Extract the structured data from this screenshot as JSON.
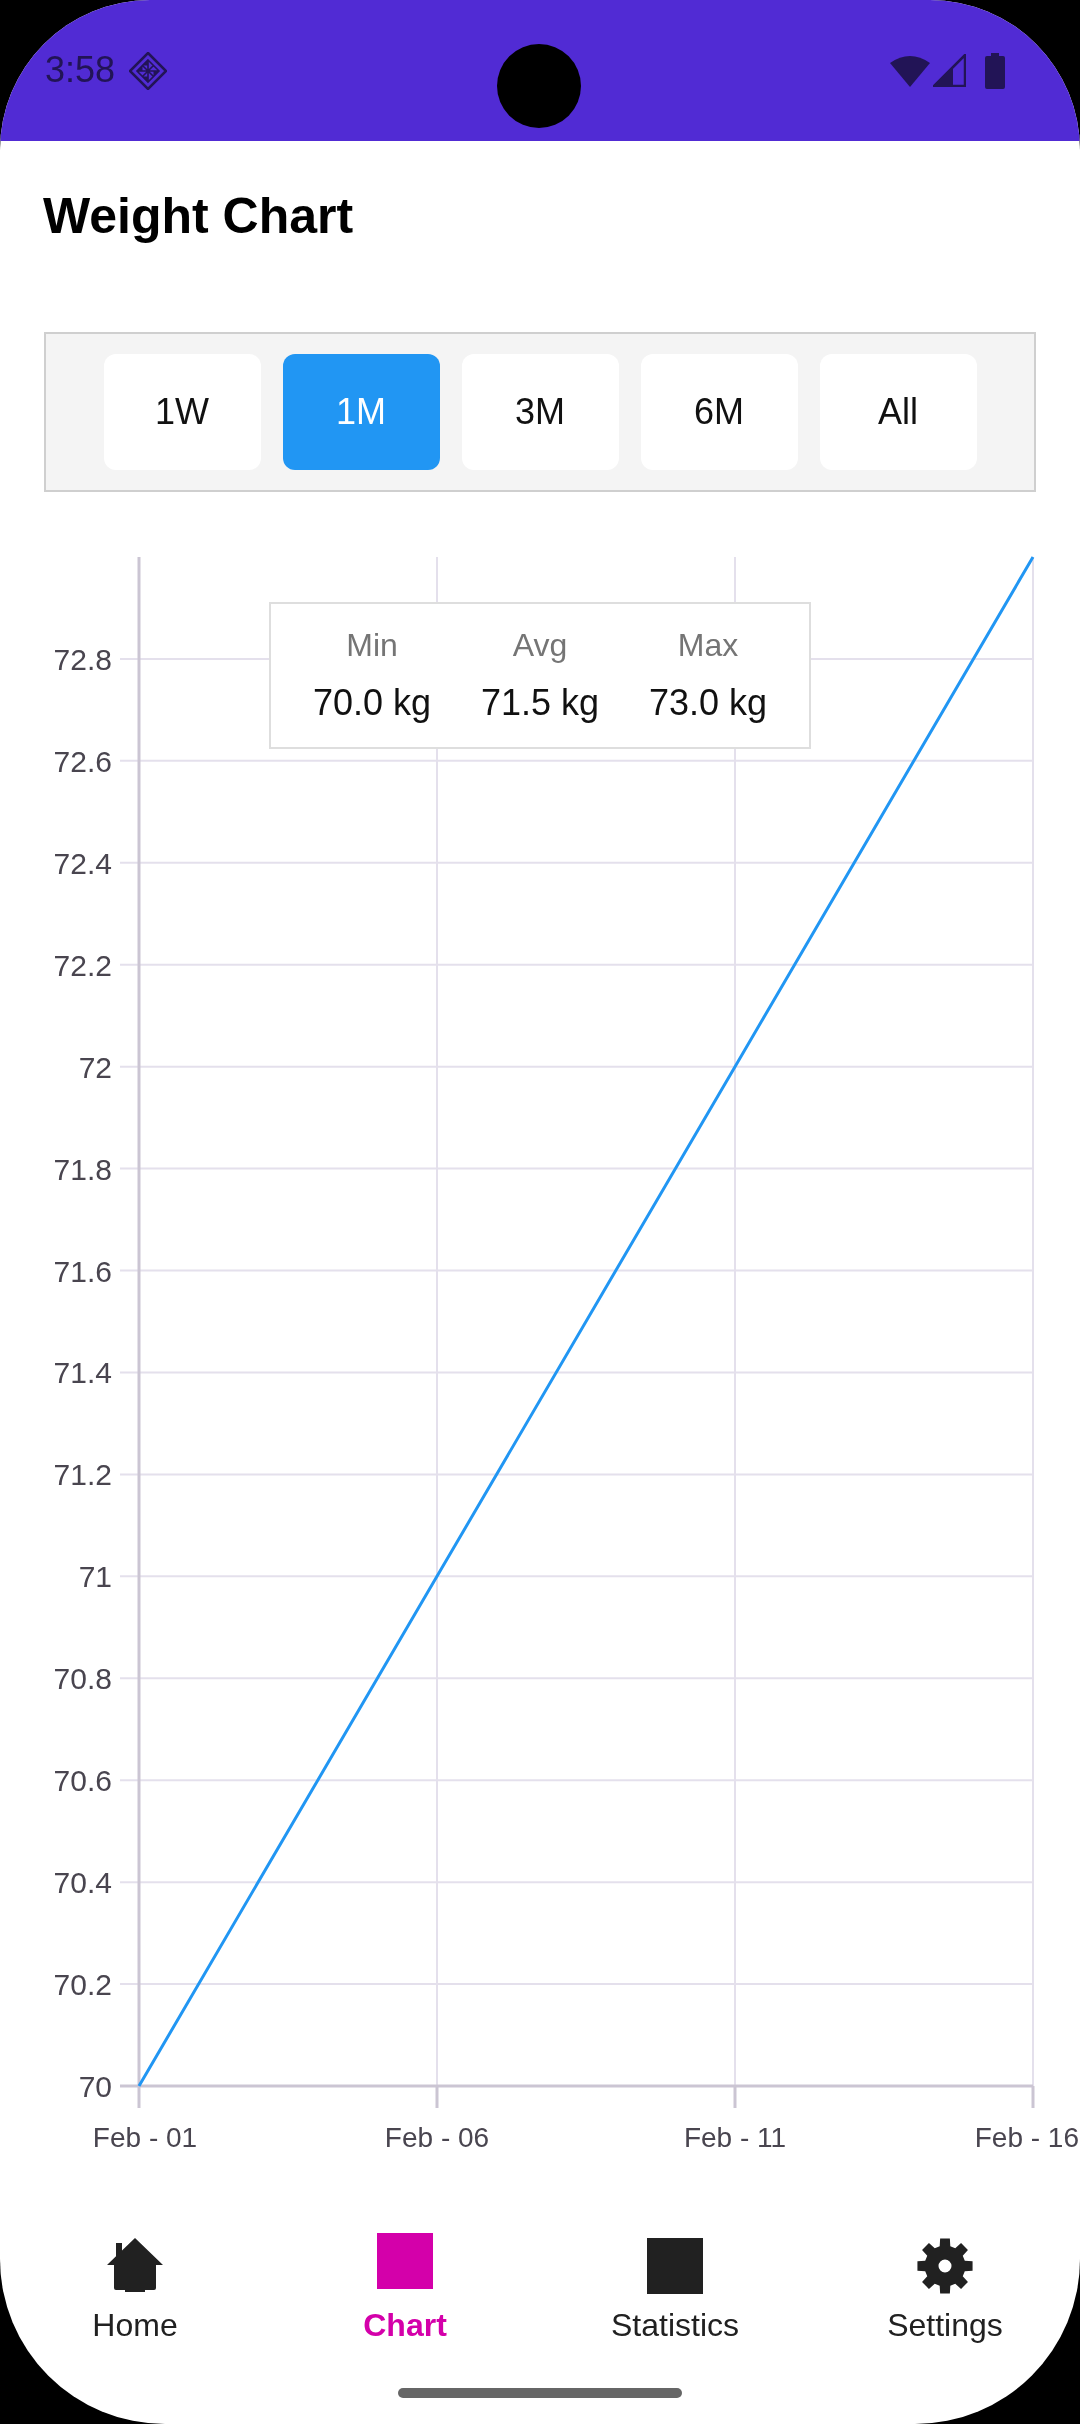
{
  "status_bar": {
    "time": "3:58"
  },
  "title": "Weight Chart",
  "ranges": [
    {
      "label": "1W",
      "selected": false
    },
    {
      "label": "1M",
      "selected": true
    },
    {
      "label": "3M",
      "selected": false
    },
    {
      "label": "6M",
      "selected": false
    },
    {
      "label": "All",
      "selected": false
    }
  ],
  "chart": {
    "stats": [
      {
        "label": "Min",
        "value": "70.0 kg"
      },
      {
        "label": "Avg",
        "value": "71.5 kg"
      },
      {
        "label": "Max",
        "value": "73.0 kg"
      }
    ],
    "chart_data": {
      "type": "line",
      "grid": true,
      "categories": [
        "Feb - 01",
        "Feb - 06",
        "Feb - 11",
        "Feb - 16"
      ],
      "series": [
        {
          "color": "#2196f3",
          "values": [
            70,
            71,
            72,
            73
          ]
        }
      ],
      "ylim": [
        70,
        73
      ],
      "yticks": [
        70,
        70.2,
        70.4,
        70.6,
        70.8,
        71,
        71.2,
        71.4,
        71.6,
        71.8,
        72,
        72.2,
        72.4,
        72.6,
        72.8
      ]
    }
  },
  "bottom_nav": [
    {
      "label": "Home",
      "kind": "house",
      "selected": false
    },
    {
      "label": "Chart",
      "kind": "square",
      "selected": true
    },
    {
      "label": "Statistics",
      "kind": "square",
      "selected": false
    },
    {
      "label": "Settings",
      "kind": "gear",
      "selected": false
    }
  ]
}
